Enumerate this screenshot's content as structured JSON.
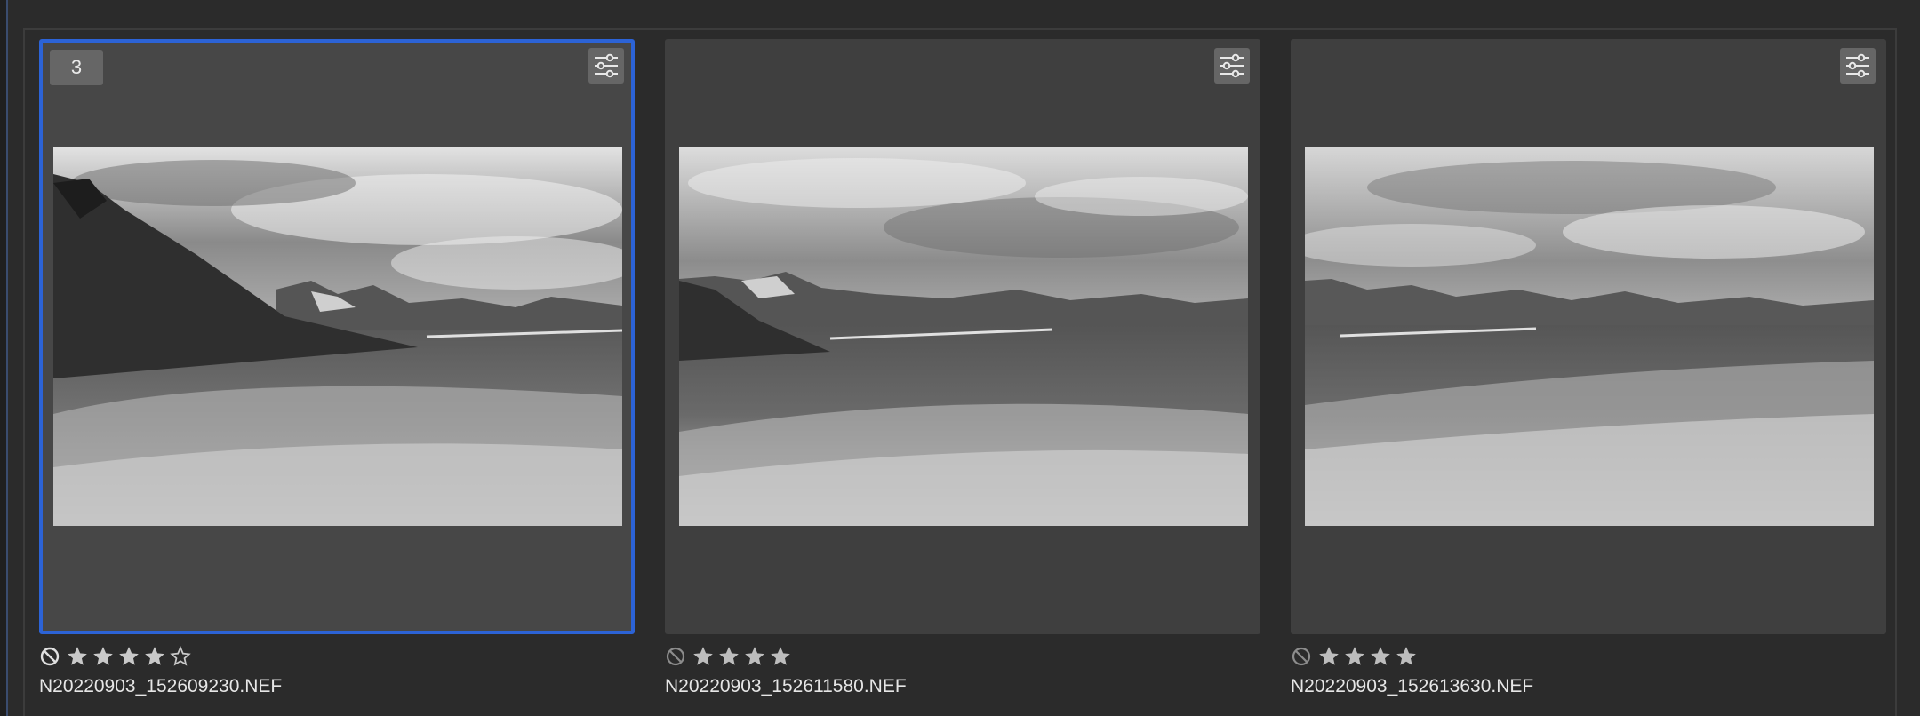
{
  "browser": {
    "tiles": [
      {
        "badge": "3",
        "filename": "N20220903_152609230.NEF",
        "rating": 4,
        "selected": true
      },
      {
        "badge": "",
        "filename": "N20220903_152611580.NEF",
        "rating": 4,
        "selected": false
      },
      {
        "badge": "",
        "filename": "N20220903_152613630.NEF",
        "rating": 4,
        "selected": false
      }
    ]
  },
  "colors": {
    "selection": "#2c63d6",
    "tile_bg": "#3f3f3f",
    "app_bg": "#2b2b2b"
  },
  "icons": {
    "adjust": "sliders-icon",
    "reject": "reject-flag-icon",
    "star": "star-icon"
  }
}
